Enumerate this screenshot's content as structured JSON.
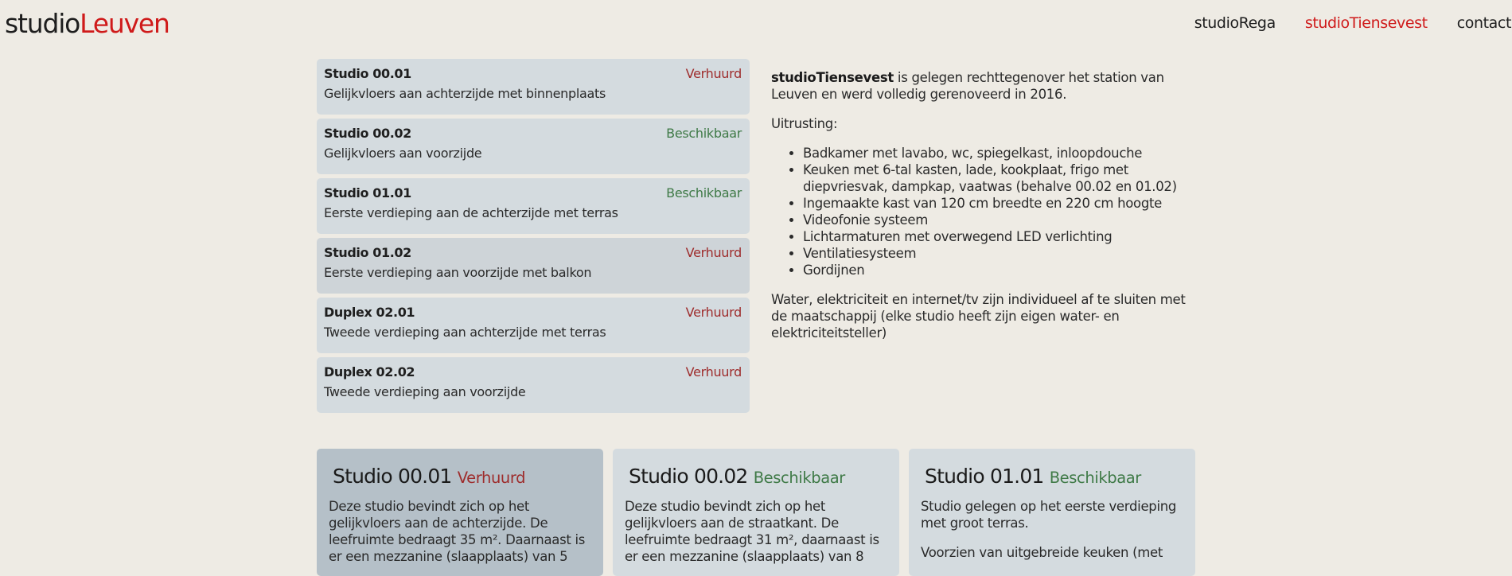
{
  "brand": {
    "part1": "studio",
    "part2": "Leuven",
    "accent_color": "#cf1a1a"
  },
  "nav": {
    "items": [
      {
        "label": "studioRega",
        "active": false
      },
      {
        "label": "studioTiensevest",
        "active": true
      },
      {
        "label": "contact",
        "active": false
      }
    ]
  },
  "studios": [
    {
      "name": "Studio 00.01",
      "status": "Verhuurd",
      "status_color": "#9e2c2c",
      "description": "Gelijkvloers aan achterzijde met binnenplaats"
    },
    {
      "name": "Studio 00.02",
      "status": "Beschikbaar",
      "status_color": "#3f7a47",
      "description": "Gelijkvloers aan voorzijde"
    },
    {
      "name": "Studio 01.01",
      "status": "Beschikbaar",
      "status_color": "#3f7a47",
      "description": "Eerste verdieping aan de achterzijde met terras"
    },
    {
      "name": "Studio 01.02",
      "status": "Verhuurd",
      "status_color": "#9e2c2c",
      "description": "Eerste verdieping aan voorzijde met balkon"
    },
    {
      "name": "Duplex 02.01",
      "status": "Verhuurd",
      "status_color": "#9e2c2c",
      "description": "Tweede verdieping aan achterzijde met terras"
    },
    {
      "name": "Duplex 02.02",
      "status": "Verhuurd",
      "status_color": "#9e2c2c",
      "description": "Tweede verdieping aan voorzijde"
    }
  ],
  "info": {
    "intro_bold": "studioTiensevest",
    "intro_rest": " is gelegen rechttegenover het station van Leuven en werd volledig gerenoveerd in 2016.",
    "equipment_label": "Uitrusting:",
    "equipment": [
      "Badkamer met lavabo, wc, spiegelkast, inloopdouche",
      "Keuken met 6-tal kasten, lade, kookplaat, frigo met diepvriesvak, dampkap, vaatwas (behalve 00.02 en 01.02)",
      "Ingemaakte kast van 120 cm breedte en 220 cm hoogte",
      "Videofonie systeem",
      "Lichtarmaturen met overwegend LED verlichting",
      "Ventilatiesysteem",
      "Gordijnen"
    ],
    "utilities": "Water, elektriciteit en internet/tv zijn individueel af te sluiten met de maatschappij (elke studio heeft zijn eigen water- en elektriciteitsteller)"
  },
  "cards": [
    {
      "title": "Studio 00.01",
      "status": "Verhuurd",
      "status_color": "#9e2c2c",
      "paragraphs": [
        "Deze studio bevindt zich op het gelijkvloers aan de achterzijde. De leefruimte bedraagt 35 m². Daarnaast is er een mezzanine (slaapplaats) van 5"
      ]
    },
    {
      "title": "Studio 00.02",
      "status": "Beschikbaar",
      "status_color": "#3f7a47",
      "paragraphs": [
        "Deze studio bevindt zich op het gelijkvloers aan de straatkant. De leefruimte bedraagt 31 m², daarnaast is er een mezzanine (slaapplaats) van 8"
      ]
    },
    {
      "title": "Studio 01.01",
      "status": "Beschikbaar",
      "status_color": "#3f7a47",
      "paragraphs": [
        "Studio gelegen op het eerste verdieping met groot terras.",
        "Voorzien van uitgebreide keuken (met"
      ]
    }
  ]
}
